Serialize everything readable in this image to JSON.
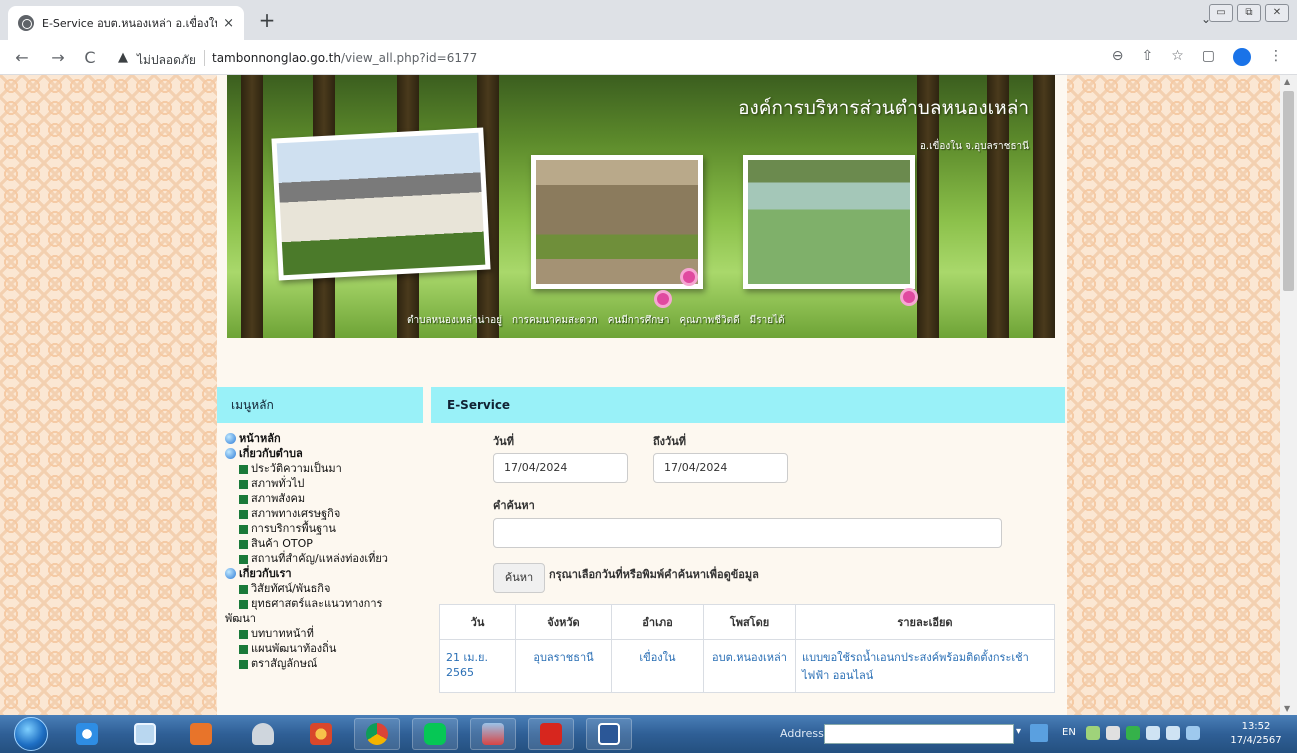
{
  "browser": {
    "tab_title": "E-Service อบต.หนองเหล่า อ.เขื่องใน",
    "tab_close": "×",
    "new_tab": "+",
    "back": "←",
    "forward": "→",
    "reload": "C",
    "security_warning_icon": "▲",
    "security_label": "ไม่ปลอดภัย",
    "url_domain": "tambonnonglao.go.th",
    "url_path": "/view_all.php?id=6177",
    "toolbar_icons": [
      "⊖",
      "⇧",
      "☆",
      "▢"
    ],
    "menu": "⋮",
    "tab_menu": "⌄",
    "win_controls": [
      "▭",
      "⧉",
      "✕"
    ]
  },
  "banner": {
    "title": "องค์การบริหารส่วนตำบลหนองเหล่า",
    "subtitle": "อ.เขื่องใน  จ.อุบลราชธานี",
    "nav": [
      "ตำบลหนองเหล่าน่าอยู่",
      "การคมนาคมสะดวก",
      "คนมีการศึกษา",
      "คุณภาพชีวิตดี",
      "มีรายได้"
    ]
  },
  "sidebar": {
    "heading": "เมนูหลัก",
    "items": [
      {
        "type": "main",
        "label": "หน้าหลัก"
      },
      {
        "type": "main",
        "label": "เกี่ยวกับตำบล"
      },
      {
        "type": "sub",
        "label": "ประวัติความเป็นมา"
      },
      {
        "type": "sub",
        "label": "สภาพทั่วไป"
      },
      {
        "type": "sub",
        "label": "สภาพสังคม"
      },
      {
        "type": "sub",
        "label": "สภาพทางเศรษฐกิจ"
      },
      {
        "type": "sub",
        "label": "การบริการพื้นฐาน"
      },
      {
        "type": "sub",
        "label": "สินค้า OTOP"
      },
      {
        "type": "sub",
        "label": "สถานที่สำคัญ/แหล่งท่องเที่ยว"
      },
      {
        "type": "main",
        "label": "เกี่ยวกับเรา"
      },
      {
        "type": "sub",
        "label": "วิสัยทัศน์/พันธกิจ"
      },
      {
        "type": "sub-wrap",
        "label": "ยุทธศาสตร์และแนวทางการ",
        "cont": "พัฒนา"
      },
      {
        "type": "sub",
        "label": "บทบาทหน้าที่"
      },
      {
        "type": "sub",
        "label": "แผนพัฒนาท้องถิ่น"
      },
      {
        "type": "sub",
        "label": "ตราสัญลักษณ์"
      }
    ]
  },
  "main": {
    "heading": "E-Service",
    "date_from_label": "วันที่",
    "date_from_value": "17/04/2024",
    "date_to_label": "ถึงวันที่",
    "date_to_value": "17/04/2024",
    "keyword_label": "คำค้นหา",
    "keyword_value": "",
    "search_button": "ค้นหา",
    "hint": "กรุณาเลือกวันที่หรือพิมพ์คำค้นหาเพื่อดูข้อมูล",
    "table": {
      "headers": [
        "วัน",
        "จังหวัด",
        "อำเภอ",
        "โพสโดย",
        "รายละเอียด"
      ],
      "rows": [
        [
          "21 เม.ย. 2565",
          "อุบลราชธานี",
          "เขื่องใน",
          "อบต.หนองเหล่า",
          "แบบขอใช้รถน้ำเอนกประสงค์พร้อมติดตั้งกระเช้าไฟฟ้า ออนไลน์"
        ]
      ]
    }
  },
  "taskbar": {
    "address_label": "Address",
    "address_value": "",
    "address_drop": "▾",
    "language": "EN",
    "time": "13:52",
    "date": "17/4/2567"
  },
  "colors": {
    "header_bar": "#99f1f8",
    "link": "#2a6fb5",
    "page_bg": "#fbe7d3"
  }
}
